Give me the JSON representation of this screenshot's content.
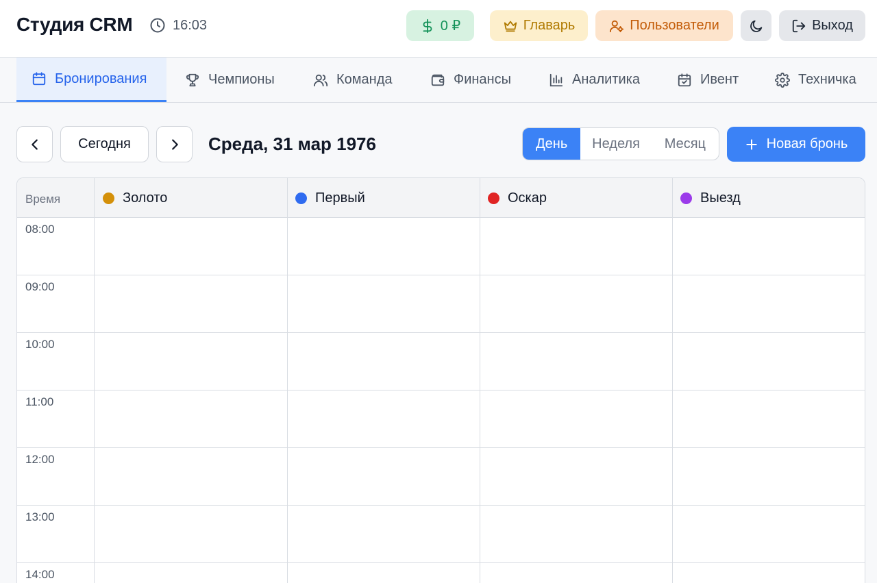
{
  "header": {
    "title": "Студия CRM",
    "time": "16:03",
    "balance": "0 ₽",
    "boss_label": "Главарь",
    "users_label": "Пользователи",
    "logout_label": "Выход",
    "colors": {
      "balance": "#15935a",
      "boss": "#b07a00",
      "users": "#c35c08"
    }
  },
  "tabs": [
    {
      "label": "Бронирования",
      "icon": "calendar-icon",
      "active": true
    },
    {
      "label": "Чемпионы",
      "icon": "trophy-icon"
    },
    {
      "label": "Команда",
      "icon": "users-icon"
    },
    {
      "label": "Финансы",
      "icon": "wallet-icon"
    },
    {
      "label": "Аналитика",
      "icon": "bar-chart-icon"
    },
    {
      "label": "Ивент",
      "icon": "calendar-check-icon"
    },
    {
      "label": "Техничка",
      "icon": "gear-icon"
    }
  ],
  "toolbar": {
    "today_label": "Сегодня",
    "date_title": "Среда, 31 мар 1976",
    "views": [
      "День",
      "Неделя",
      "Месяц"
    ],
    "active_view": "День",
    "new_booking_label": "Новая бронь",
    "accent": "#3b82f6"
  },
  "calendar": {
    "time_header": "Время",
    "rooms": [
      {
        "name": "Золото",
        "color": "#d4900a"
      },
      {
        "name": "Первый",
        "color": "#2f6bf0"
      },
      {
        "name": "Оскар",
        "color": "#e02424"
      },
      {
        "name": "Выезд",
        "color": "#9b3bea"
      }
    ],
    "slots": [
      "08:00",
      "09:00",
      "10:00",
      "11:00",
      "12:00",
      "13:00",
      "14:00"
    ]
  }
}
